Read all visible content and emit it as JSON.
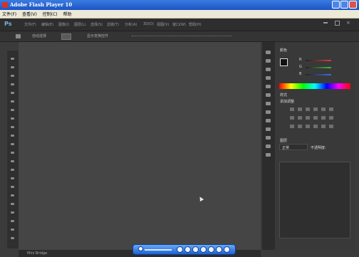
{
  "window": {
    "title": "Adobe Flash Player 10"
  },
  "menubar": {
    "items": [
      "文件(F)",
      "查看(V)",
      "控制(C)",
      "帮助"
    ]
  },
  "photoshop": {
    "logo": "Ps",
    "menu": [
      "文件(F)",
      "编辑(E)",
      "图像(I)",
      "图层(L)",
      "选择(S)",
      "滤镜(T)",
      "分析(A)",
      "3D(D)",
      "视图(V)",
      "窗口(W)",
      "帮助(H)"
    ],
    "options": {
      "auto_select": "自动选择",
      "show_transform": "显示变换控件"
    }
  },
  "panels": {
    "color_tab": "颜色",
    "color_labels": {
      "r": "R",
      "g": "G",
      "b": "B"
    },
    "swatches_tab": "样式",
    "adjust_title": "添加调整",
    "layers_tab": "图层",
    "layers_mode": "正常",
    "opacity_label": "不透明度:"
  },
  "status": {
    "text": "Mini Bridge"
  },
  "icons": [
    "flash-app-icon",
    "minimize-icon",
    "maximize-icon",
    "close-icon",
    "move-tool-icon",
    "play-icon",
    "rewind-icon",
    "forward-icon",
    "stop-icon",
    "loop-icon"
  ]
}
